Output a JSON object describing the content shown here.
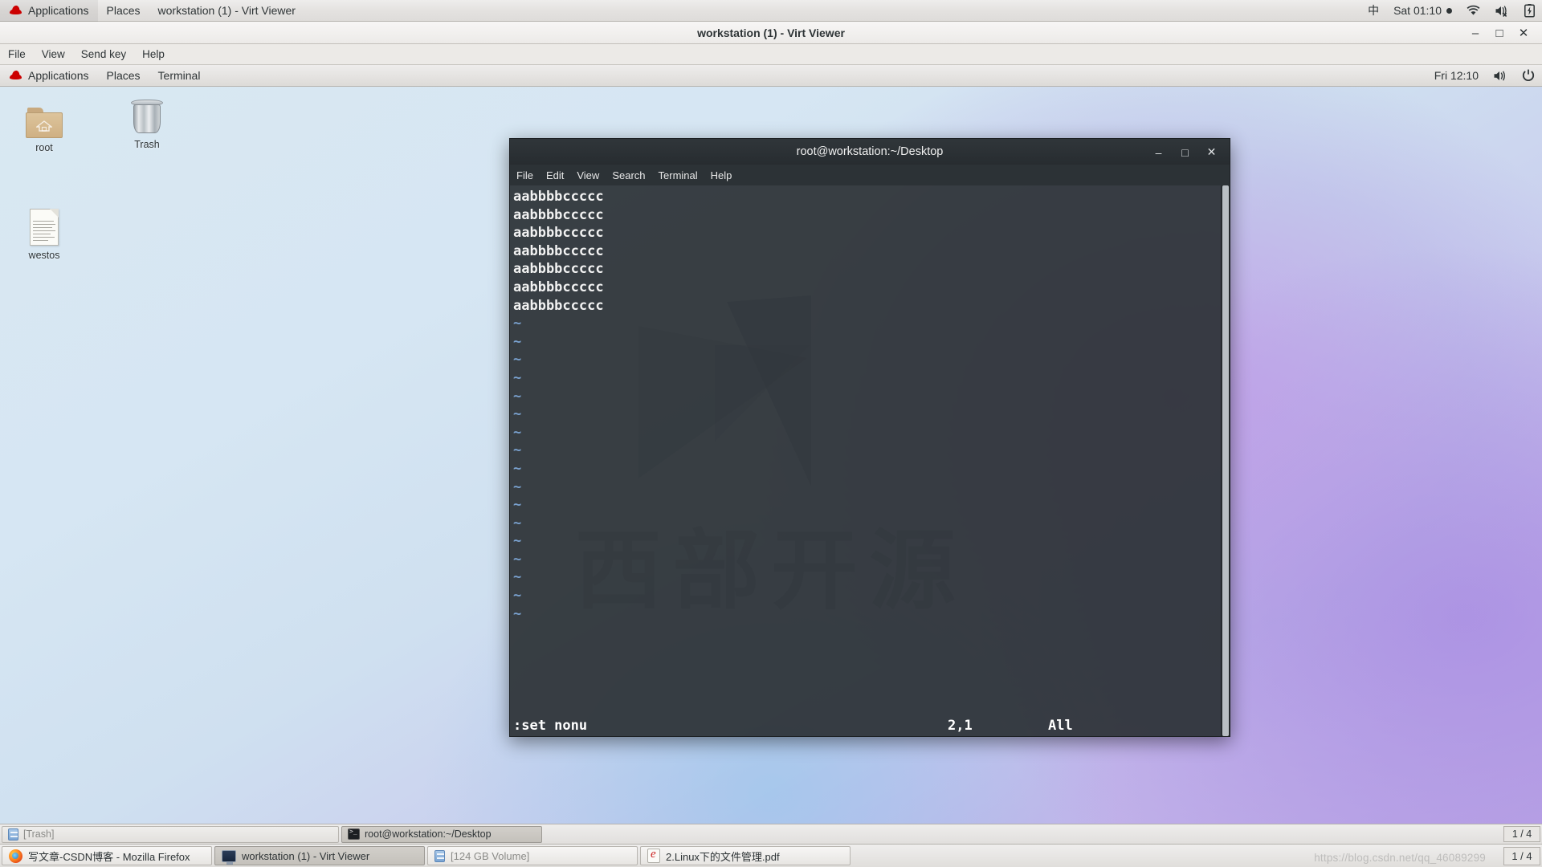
{
  "host_panel": {
    "redhat_icon": "redhat-icon",
    "menus": [
      {
        "label": "Applications",
        "name": "applications-menu"
      },
      {
        "label": "Places",
        "name": "places-menu"
      },
      {
        "label": "workstation (1) - Virt Viewer",
        "name": "window-menu-virt-viewer"
      }
    ],
    "tray": {
      "input_method": "中",
      "clock": "Sat 01:10",
      "recording_dot": "recording-indicator",
      "wifi_icon": "wifi-icon",
      "volume_muted_icon": "volume-muted-icon",
      "battery_icon": "battery-charging-icon"
    }
  },
  "virt_viewer": {
    "title": "workstation (1) - Virt Viewer",
    "menus": [
      {
        "label": "File",
        "name": "vv-menu-file"
      },
      {
        "label": "View",
        "name": "vv-menu-view"
      },
      {
        "label": "Send key",
        "name": "vv-menu-send-key"
      },
      {
        "label": "Help",
        "name": "vv-menu-help"
      }
    ],
    "window_buttons": {
      "minimize": "–",
      "maximize": "□",
      "close": "✕"
    }
  },
  "guest_panel": {
    "redhat_icon": "redhat-icon",
    "menus": [
      {
        "label": "Applications",
        "name": "guest-applications-menu"
      },
      {
        "label": "Places",
        "name": "guest-places-menu"
      },
      {
        "label": "Terminal",
        "name": "guest-window-menu-terminal"
      }
    ],
    "tray": {
      "clock": "Fri 12:10",
      "volume_icon": "volume-icon",
      "power_icon": "power-icon"
    }
  },
  "desktop": {
    "wallpaper_text": "西部开源",
    "icons": [
      {
        "label": "root",
        "name": "desktop-icon-root",
        "type": "home-folder-icon"
      },
      {
        "label": "Trash",
        "name": "desktop-icon-trash",
        "type": "trash-icon"
      },
      {
        "label": "westos",
        "name": "desktop-icon-westos",
        "type": "text-document-icon"
      }
    ]
  },
  "terminal": {
    "title": "root@workstation:~/Desktop",
    "menus": [
      {
        "label": "File",
        "name": "term-menu-file"
      },
      {
        "label": "Edit",
        "name": "term-menu-edit"
      },
      {
        "label": "View",
        "name": "term-menu-view"
      },
      {
        "label": "Search",
        "name": "term-menu-search"
      },
      {
        "label": "Terminal",
        "name": "term-menu-terminal"
      },
      {
        "label": "Help",
        "name": "term-menu-help"
      }
    ],
    "window_buttons": {
      "minimize": "–",
      "maximize": "□",
      "close": "✕"
    },
    "vim": {
      "text_lines": [
        "aabbbbccccc",
        "aabbbbccccc",
        "aabbbbccccc",
        "aabbbbccccc",
        "aabbbbccccc",
        "aabbbbccccc",
        "aabbbbccccc"
      ],
      "empty_line_marker": "~",
      "empty_line_count": 17,
      "command_line": ":set nonu",
      "cursor_position": "2,1",
      "scroll_scope": "All"
    }
  },
  "guest_taskbar": {
    "items": [
      {
        "label": "[Trash]",
        "name": "guest-task-trash",
        "state": "minimized",
        "icon": "drive-icon"
      },
      {
        "label": "root@workstation:~/Desktop",
        "name": "guest-task-terminal",
        "state": "active",
        "icon": "terminal-icon"
      }
    ],
    "workspace": "1 / 4"
  },
  "host_taskbar": {
    "items": [
      {
        "label": "写文章-CSDN博客 - Mozilla Firefox",
        "name": "host-task-firefox",
        "state": "normal",
        "icon": "firefox-icon"
      },
      {
        "label": "workstation (1) - Virt Viewer",
        "name": "host-task-virt-viewer",
        "state": "active",
        "icon": "virt-viewer-icon"
      },
      {
        "label": "[124 GB Volume]",
        "name": "host-task-volume",
        "state": "minimized",
        "icon": "drive-icon"
      },
      {
        "label": "2.Linux下的文件管理.pdf",
        "name": "host-task-pdf",
        "state": "normal",
        "icon": "pdf-icon"
      }
    ],
    "workspace": "1 / 4",
    "watermark": "https://blog.csdn.net/qq_46089299"
  },
  "colors": {
    "panel_bg": "#e8e6e3",
    "terminal_bg": "#2c3236",
    "terminal_fg": "#f2f2f2",
    "vim_tilde": "#7aa2d0",
    "redhat_red": "#cc0000",
    "accent_purple": "#bca8e6"
  }
}
